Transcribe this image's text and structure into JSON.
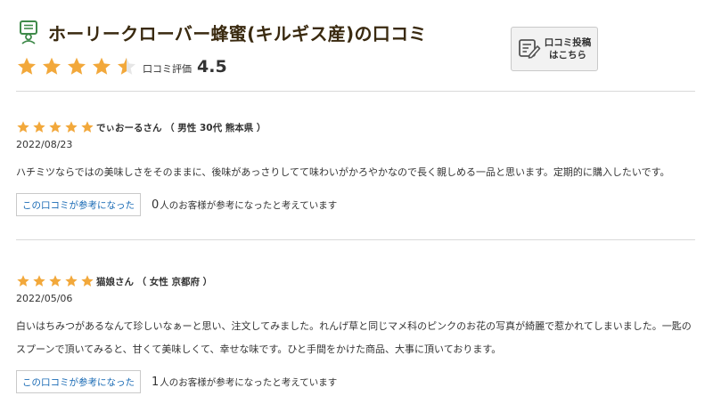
{
  "header": {
    "title": "ホーリークローバー蜂蜜(キルギス産)の口コミ",
    "rating_label": "口コミ評価",
    "rating_value": "4.5",
    "post_button_label": "口コミ投稿\nはこちら",
    "rating_stars": 4.5
  },
  "reviews": [
    {
      "stars": 5,
      "reviewer": "でぃおーるさん （ 男性 30代 熊本県 ）",
      "date": "2022/08/23",
      "body": "ハチミツならではの美味しさをそのままに、後味があっさりしてて味わいがかろやかなので長く親しめる一品と思います。定期的に購入したいです。",
      "helpful_button": "この口コミが参考になった",
      "helpful_count": "0",
      "helpful_text": "人のお客様が参考になったと考えています"
    },
    {
      "stars": 5,
      "reviewer": "猫娘さん （ 女性 京都府 ）",
      "date": "2022/05/06",
      "body": "白いはちみつがあるなんて珍しいなぁーと思い、注文してみました。れんげ草と同じマメ科のピンクのお花の写真が綺麗で惹かれてしまいました。一匙のスプーンで頂いてみると、甘くて美味しくて、幸せな味です。ひと手間をかけた商品、大事に頂いております。",
      "helpful_button": "この口コミが参考になった",
      "helpful_count": "1",
      "helpful_text": "人のお客様が参考になったと考えています"
    }
  ],
  "colors": {
    "star": "#f2a83b",
    "star_empty": "#e6e6e6",
    "link": "#1a6bb5",
    "icon_green": "#3f8a4a"
  },
  "icons": {
    "title": "review-person-icon",
    "post": "pen-note-icon",
    "star": "star-icon"
  }
}
